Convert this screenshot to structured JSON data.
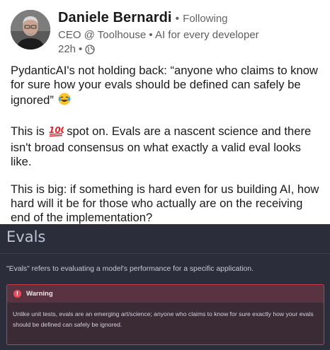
{
  "post": {
    "author_name": "Daniele Bernardi",
    "separator": "•",
    "follow_status": "Following",
    "headline": "CEO @ Toolhouse • AI for every developer",
    "time_ago": "22h",
    "visibility_icon": "globe-icon",
    "paragraphs": [
      "PydanticAI's not holding back: “anyone who claims to know for sure how your evals should be defined can safely be ignored”",
      "spot on. Evals are a nascent science and there isn't broad consensus on what exactly a valid eval looks like.",
      "This is big: if something is hard even for us building AI, how hard will it be for those who actually are on the receiving end of the implementation?"
    ],
    "p2_prefix": "This is",
    "emoji_laugh": "face-with-tears-of-joy",
    "emoji_hundred": "hundred-points"
  },
  "docs": {
    "title": "Evals",
    "intro": "\"Evals\" refers to evaluating a model's performance for a specific application.",
    "warning": {
      "label": "Warning",
      "text": "Unlike unit tests, evals are an emerging art/science; anyone who claims to know for sure exactly how your evals should be defined can safely be ignored."
    }
  },
  "colors": {
    "panel_bg": "#2b2d3a",
    "warning_border": "#c43b4b",
    "warning_head_bg": "#5a3340",
    "warning_icon": "#e84b5b"
  }
}
